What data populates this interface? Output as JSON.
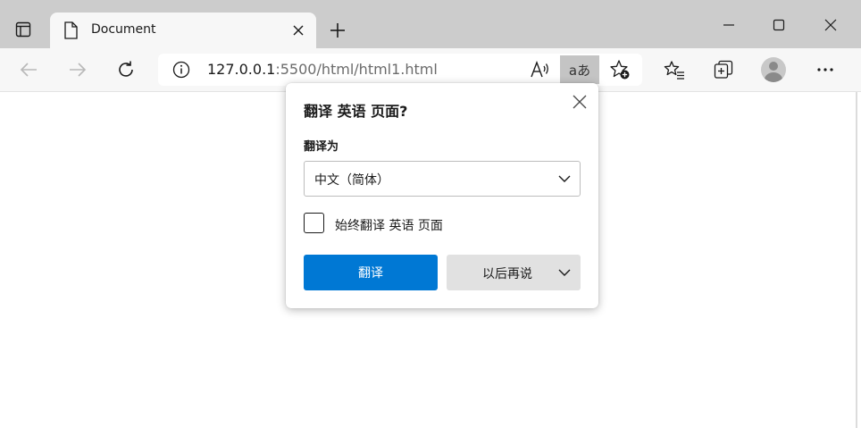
{
  "tab": {
    "title": "Document"
  },
  "address": {
    "url_host": "127.0.0.1",
    "url_rest": ":5500/html/html1.html",
    "translate_glyph": "aあ"
  },
  "translate_popup": {
    "title": "翻译 英语 页面?",
    "target_label": "翻译为",
    "selected_language": "中文（简体）",
    "always_translate_label": "始终翻译 英语 页面",
    "always_translate_checked": false,
    "translate_button": "翻译",
    "not_now_button": "以后再说"
  },
  "icons": {
    "tab_actions": "tab-actions-icon",
    "document": "document-icon",
    "close": "close-icon",
    "new_tab": "plus-icon",
    "minimize": "minimize-icon",
    "maximize": "maximize-icon",
    "back": "back-arrow-icon",
    "forward": "forward-arrow-icon",
    "refresh": "refresh-icon",
    "info": "info-icon",
    "read_aloud": "read-aloud-icon",
    "add_favorite": "star-add-icon",
    "favorites": "favorites-icon",
    "collections": "collections-icon",
    "more": "more-icon"
  },
  "colors": {
    "tabstrip": "#cccccc",
    "toolbar": "#f7f7f7",
    "primary_button": "#0078d4",
    "secondary_button": "#e1e1e1",
    "translate_active": "#c4c4c4"
  }
}
